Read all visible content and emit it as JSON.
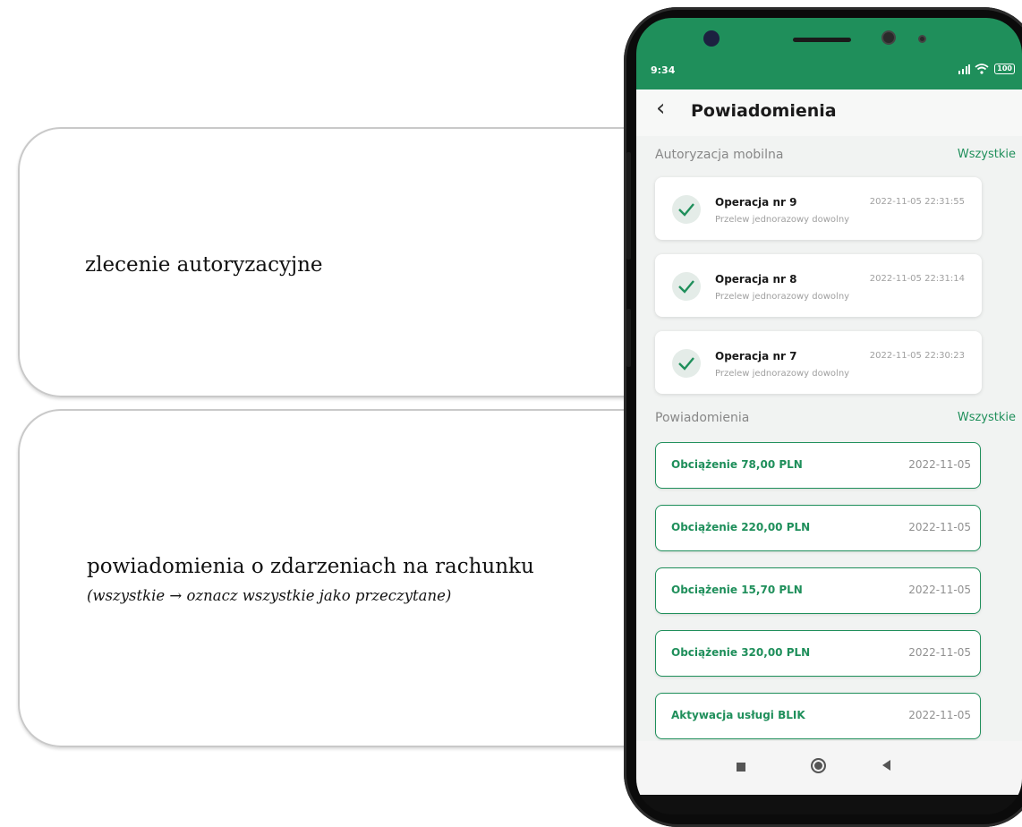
{
  "callouts": {
    "auth": "zlecenie autoryzacyjne",
    "notifications": "powiadomienia o zdarzeniach na rachunku",
    "notifications_hint": "(wszystkie  → oznacz wszystkie jako przeczytane)"
  },
  "status_bar": {
    "time": "9:34",
    "icons": [
      "signal-icon",
      "wifi-icon",
      "battery-icon"
    ],
    "battery_label": "100"
  },
  "header": {
    "back_icon": "chevron-left-icon",
    "title": "Powiadomienia"
  },
  "auth_section": {
    "label": "Autoryzacja mobilna",
    "link": "Wszystkie",
    "items": [
      {
        "name": "Operacja nr 9",
        "desc": "Przelew jednorazowy dowolny",
        "date": "2022-11-05 22:31:55"
      },
      {
        "name": "Operacja nr 8",
        "desc": "Przelew jednorazowy dowolny",
        "date": "2022-11-05 22:31:14"
      },
      {
        "name": "Operacja nr 7",
        "desc": "Przelew jednorazowy dowolny",
        "date": "2022-11-05 22:30:23"
      }
    ]
  },
  "notifications_section": {
    "label": "Powiadomienia",
    "link": "Wszystkie",
    "items": [
      {
        "title": "Obciążenie 78,00 PLN",
        "date": "2022-11-05"
      },
      {
        "title": "Obciążenie 220,00 PLN",
        "date": "2022-11-05"
      },
      {
        "title": "Obciążenie 15,70 PLN",
        "date": "2022-11-05"
      },
      {
        "title": "Obciążenie 320,00 PLN",
        "date": "2022-11-05"
      },
      {
        "title": "Aktywacja usługi BLIK",
        "date": "2022-11-05"
      }
    ]
  },
  "colors": {
    "brand": "#1f8f5b",
    "background": "#f1f3f2"
  }
}
